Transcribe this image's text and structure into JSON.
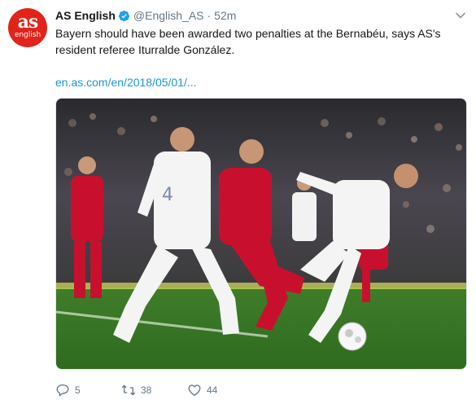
{
  "tweet": {
    "author_name": "AS English",
    "handle": "@English_AS",
    "separator": "·",
    "time": "52m",
    "text": "Bayern should have been awarded two penalties at the Bernabéu, says AS's resident referee Iturralde González.",
    "link": "en.as.com/en/2018/05/01/...",
    "avatar": {
      "logo_text": "as",
      "logo_sub": "english",
      "color": "#e2231a"
    },
    "verified_icon": "verified-badge-icon",
    "media_description_icon": "photo",
    "actions": {
      "reply_count": "5",
      "retweet_count": "38",
      "like_count": "44"
    },
    "colors": {
      "link": "#1b95e0",
      "muted": "#657786",
      "verified": "#1da1f2"
    }
  }
}
